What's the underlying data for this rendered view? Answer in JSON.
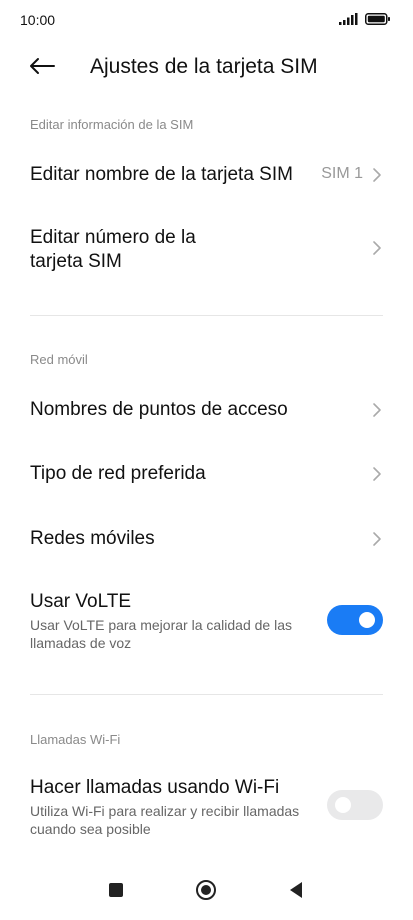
{
  "status": {
    "time": "10:00",
    "signal_icon": "signal-icon",
    "battery_icon": "battery-icon"
  },
  "header": {
    "title": "Ajustes de la tarjeta SIM",
    "back_icon": "back-arrow-icon"
  },
  "sections": {
    "sim_info": {
      "label": "Editar información de la SIM",
      "edit_name": {
        "title": "Editar nombre de la tarjeta SIM",
        "value": "SIM 1"
      },
      "edit_number": {
        "title_line1": "Editar número de la",
        "title_line2": "tarjeta SIM"
      }
    },
    "mobile_network": {
      "label": "Red móvil",
      "apn": {
        "title": "Nombres de puntos de acceso"
      },
      "preferred_network": {
        "title": "Tipo de red preferida"
      },
      "mobile_networks": {
        "title": "Redes móviles"
      },
      "volte": {
        "title": "Usar VoLTE",
        "subtitle": "Usar VoLTE para mejorar la calidad de las llamadas de voz",
        "enabled": true
      }
    },
    "wifi_calls": {
      "label": "Llamadas Wi-Fi",
      "wifi_calling": {
        "title": "Hacer llamadas usando Wi-Fi",
        "subtitle": "Utiliza Wi-Fi para realizar y recibir llamadas cuando sea posible",
        "enabled": false
      }
    }
  },
  "colors": {
    "accent": "#1a7cf5",
    "toggle_off": "#e9e9ea"
  },
  "nav": {
    "recents_icon": "square-icon",
    "home_icon": "home-circle-icon",
    "back_icon": "back-triangle-icon"
  }
}
